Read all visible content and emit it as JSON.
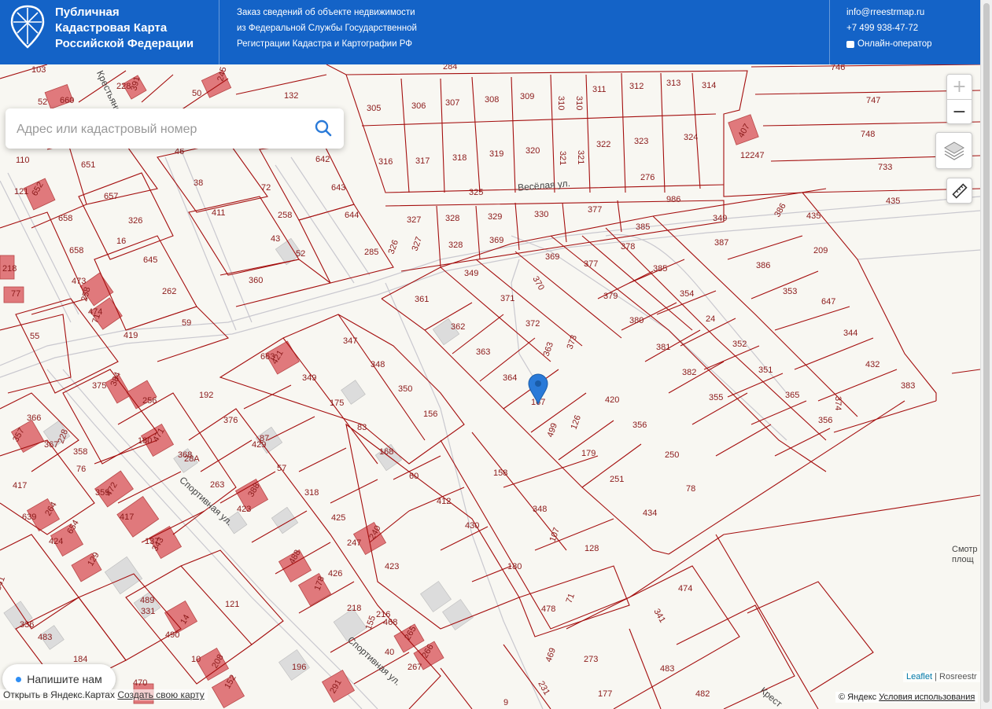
{
  "header": {
    "title_lines": [
      "Публичная",
      "Кадастровая Карта",
      "Российской Федерации"
    ],
    "desc_lines": [
      "Заказ сведений об объекте недвижимости",
      "из Федеральной Службы Государственной",
      "Регистрации Кадастра и Картографии РФ"
    ],
    "email": "info@rreestrmap.ru",
    "phone": "+7 499 938-47-72",
    "chat_label": "Онлайн-оператор"
  },
  "search": {
    "placeholder": "Адрес или кадастровый номер",
    "icon": "search-icon"
  },
  "controls": {
    "zoom_in": "+",
    "zoom_out": "−",
    "layers_icon": "layers-icon",
    "ruler_icon": "ruler-icon"
  },
  "chat_button": {
    "label": "Напишите нам"
  },
  "attribution": {
    "leaflet": "Leaflet",
    "separator": " | ",
    "source": "Rosreestr"
  },
  "yandex": {
    "copyright": "© Яндекс",
    "terms": "Условия использования"
  },
  "yandex_open": {
    "prefix": "Открыть в Яндекс.Картах",
    "link": "Создать свою карту"
  },
  "cutoff_label": [
    "Смотр",
    "площ"
  ],
  "streets": [
    {
      "name": "Весёлая ул."
    },
    {
      "name": "Спортивная ул."
    },
    {
      "name": "Спортивная ул."
    },
    {
      "name": "Крестьянская ул."
    },
    {
      "name": "Крест"
    }
  ],
  "colors": {
    "header": "#1463c7",
    "parcel_line": "#a40e0e",
    "building": "#e0797c",
    "map_bg": "#f8f7f2"
  },
  "parcel_labels": [
    "103",
    "660",
    "228",
    "391",
    "50",
    "245",
    "418",
    "132",
    "52",
    "284",
    "746",
    "305",
    "306",
    "307",
    "308",
    "309",
    "310",
    "310",
    "311",
    "312",
    "313",
    "314",
    "747",
    "110",
    "651",
    "46",
    "642",
    "316",
    "317",
    "318",
    "319",
    "320",
    "321",
    "321",
    "322",
    "323",
    "324",
    "407",
    "12247",
    "748",
    "733",
    "121",
    "652",
    "657",
    "38",
    "72",
    "643",
    "411",
    "258",
    "644",
    "325",
    "276",
    "986",
    "435",
    "658",
    "326",
    "327",
    "328",
    "329",
    "330",
    "377",
    "385",
    "349",
    "386",
    "435",
    "658",
    "16",
    "645",
    "285",
    "326",
    "327",
    "328",
    "369",
    "369",
    "377",
    "378",
    "385",
    "387",
    "386",
    "209",
    "218",
    "473",
    "258",
    "43",
    "52",
    "360",
    "349",
    "370",
    "379",
    "354",
    "353",
    "647",
    "77",
    "474",
    "71",
    "262",
    "361",
    "371",
    "380",
    "24",
    "55",
    "59",
    "362",
    "372",
    "381",
    "352",
    "344",
    "419",
    "347",
    "363",
    "363",
    "373",
    "382",
    "351",
    "432",
    "663",
    "421",
    "348",
    "364",
    "374",
    "383",
    "349",
    "350",
    "167",
    "420",
    "355",
    "365",
    "375",
    "384",
    "256",
    "192",
    "175",
    "156",
    "499",
    "126",
    "356",
    "356",
    "366",
    "376",
    "83",
    "168",
    "179",
    "250",
    "357",
    "367",
    "228",
    "180",
    "471",
    "87",
    "429",
    "60",
    "158",
    "251",
    "78",
    "358",
    "368",
    "28A",
    "57",
    "412",
    "348",
    "434",
    "76",
    "359",
    "472",
    "263",
    "388",
    "318",
    "430",
    "107",
    "128",
    "417",
    "417",
    "423",
    "425",
    "247",
    "240",
    "180",
    "639",
    "264",
    "424",
    "654",
    "137",
    "343",
    "426",
    "423",
    "474",
    "129",
    "488",
    "178",
    "218",
    "216",
    "478",
    "71",
    "341",
    "341",
    "489",
    "331",
    "121",
    "155",
    "265",
    "468",
    "336",
    "490",
    "14",
    "40",
    "266",
    "469",
    "273",
    "483",
    "483",
    "10",
    "208",
    "196",
    "267",
    "184",
    "470",
    "152",
    "291",
    "231",
    "177",
    "482",
    "9",
    "25",
    "491"
  ]
}
